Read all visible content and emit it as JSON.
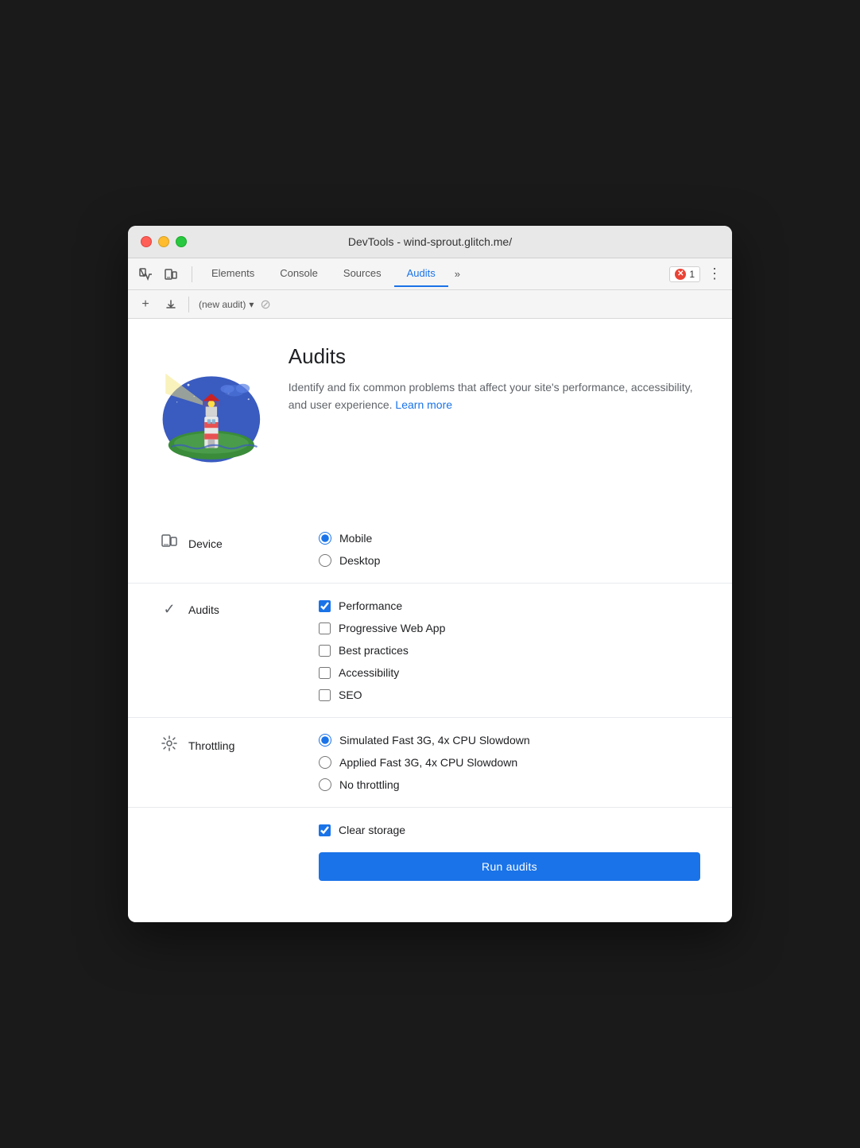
{
  "titlebar": {
    "title": "DevTools - wind-sprout.glitch.me/"
  },
  "tabs": {
    "items": [
      {
        "id": "elements",
        "label": "Elements",
        "active": false
      },
      {
        "id": "console",
        "label": "Console",
        "active": false
      },
      {
        "id": "sources",
        "label": "Sources",
        "active": false
      },
      {
        "id": "audits",
        "label": "Audits",
        "active": true
      }
    ],
    "more_label": "»"
  },
  "toolbar": {
    "error_count": "1",
    "audit_select_label": "(new audit)"
  },
  "hero": {
    "title": "Audits",
    "description": "Identify and fix common problems that affect your site's performance, accessibility, and user experience.",
    "learn_more": "Learn more"
  },
  "device_section": {
    "label": "Device",
    "options": [
      {
        "id": "mobile",
        "label": "Mobile",
        "checked": true
      },
      {
        "id": "desktop",
        "label": "Desktop",
        "checked": false
      }
    ]
  },
  "audits_section": {
    "label": "Audits",
    "options": [
      {
        "id": "performance",
        "label": "Performance",
        "checked": true
      },
      {
        "id": "pwa",
        "label": "Progressive Web App",
        "checked": false
      },
      {
        "id": "best-practices",
        "label": "Best practices",
        "checked": false
      },
      {
        "id": "accessibility",
        "label": "Accessibility",
        "checked": false
      },
      {
        "id": "seo",
        "label": "SEO",
        "checked": false
      }
    ]
  },
  "throttling_section": {
    "label": "Throttling",
    "options": [
      {
        "id": "simulated",
        "label": "Simulated Fast 3G, 4x CPU Slowdown",
        "checked": true
      },
      {
        "id": "applied",
        "label": "Applied Fast 3G, 4x CPU Slowdown",
        "checked": false
      },
      {
        "id": "none",
        "label": "No throttling",
        "checked": false
      }
    ]
  },
  "bottom_section": {
    "clear_storage_label": "Clear storage",
    "clear_storage_checked": true,
    "run_button_label": "Run audits"
  }
}
